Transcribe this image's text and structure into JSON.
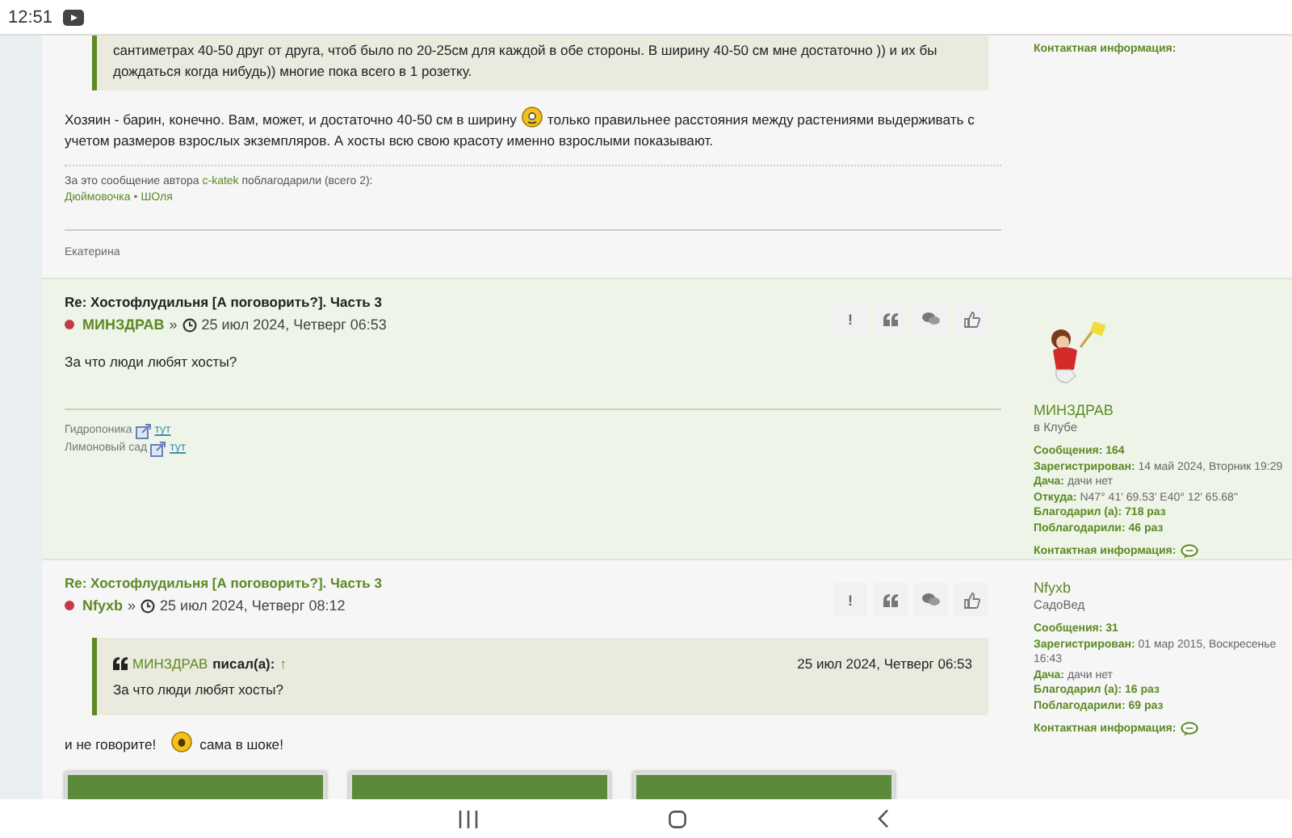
{
  "status_bar": {
    "time": "12:51"
  },
  "previous_post": {
    "quote_lines": [
      "сантиметрах 40-50 друг от друга, чтоб было по 20-25см для каждой в обе стороны. В ширину 40-50 см мне достаточно )) и их бы",
      "дождаться когда нибудь)) многие пока всего в 1 розетку."
    ],
    "body": [
      {
        "kind": "text",
        "text": "Хозяин - барин, конечно. Вам, может, и достаточно 40-50 см в ширину"
      },
      {
        "kind": "smiley"
      },
      {
        "kind": "text",
        "text": "только правильнее расстояния между растениями выдерживать с учетом размеров взрослых экземпляров. А хосты всю свою красоту именно взрослыми показывают."
      }
    ],
    "thanks": {
      "prefix": "За это сообщение автора",
      "author": "c-katek",
      "suffix": "поблагодарили (всего 2):",
      "users": [
        "Дюймовочка",
        "ШОля"
      ],
      "separator": "•"
    },
    "signature": "Екатерина",
    "contact_label": "Контактная информация:"
  },
  "posts": [
    {
      "highlighted": true,
      "title": "Re: Хостофлудильня [А поговорить?]. Часть 3",
      "author": "МИНЗДРАВ",
      "separator": "»",
      "date": "25 июл 2024, Четверг 06:53",
      "buttons": [
        {
          "kind": "text",
          "label": "!"
        },
        {
          "kind": "quote"
        },
        {
          "kind": "reply"
        },
        {
          "kind": "like"
        }
      ],
      "body": [
        {
          "kind": "text",
          "text": "За что люди любят хосты?"
        }
      ],
      "signature_links": [
        {
          "label": "Гидропоника",
          "link": "тут"
        },
        {
          "label": "Лимоновый сад",
          "link": "тут"
        }
      ],
      "profile": {
        "avatar": true,
        "name": "МИНЗДРАВ",
        "rank": "в Клубе",
        "stats": [
          {
            "label": "Сообщения:",
            "value": "164",
            "kind": "count"
          },
          {
            "label": "Зарегистрирован:",
            "value": "14 май 2024, Вторник 19:29",
            "kind": "plain"
          },
          {
            "label": "Дача:",
            "value": "дачи нет",
            "kind": "plain"
          },
          {
            "label": "Откуда:",
            "value": "N47° 41' 69.53' E40° 12' 65.68\"",
            "kind": "plain"
          },
          {
            "label": "Благодарил (а):",
            "value": "718 раз",
            "kind": "count"
          },
          {
            "label": "Поблагодарили:",
            "value": "46 раз",
            "kind": "count"
          }
        ],
        "contact_label": "Контактная информация:"
      }
    },
    {
      "highlighted": false,
      "title": "Re: Хостофлудильня [А поговорить?]. Часть 3",
      "author": "Nfyxb",
      "separator": "»",
      "date": "25 июл 2024, Четверг 08:12",
      "buttons": [
        {
          "kind": "text",
          "label": "!"
        },
        {
          "kind": "quote"
        },
        {
          "kind": "reply"
        },
        {
          "kind": "like"
        }
      ],
      "quote": {
        "author": "МИНЗДРАВ",
        "wrote": "писал(а):",
        "arrow": "↑",
        "date": "25 июл 2024, Четверг 06:53",
        "text": "За что люди любят хосты?"
      },
      "body": [
        {
          "kind": "text",
          "text": "и не говорите!"
        },
        {
          "kind": "smiley"
        },
        {
          "kind": "text",
          "text": "сама в шоке!"
        }
      ],
      "attachments": [
        {
          "kind": "photo"
        },
        {
          "kind": "photo"
        },
        {
          "kind": "photo"
        }
      ],
      "profile": {
        "avatar": false,
        "name": "Nfyxb",
        "rank": "СадоВед",
        "stats": [
          {
            "label": "Сообщения:",
            "value": "31",
            "kind": "count"
          },
          {
            "label": "Зарегистрирован:",
            "value": "01 мар 2015, Воскресенье 16:43",
            "kind": "plain"
          },
          {
            "label": "Дача:",
            "value": "дачи нет",
            "kind": "plain"
          },
          {
            "label": "Благодарил (а):",
            "value": "16 раз",
            "kind": "count"
          },
          {
            "label": "Поблагодарили:",
            "value": "69 раз",
            "kind": "count"
          }
        ],
        "contact_label": "Контактная информация:"
      }
    }
  ]
}
